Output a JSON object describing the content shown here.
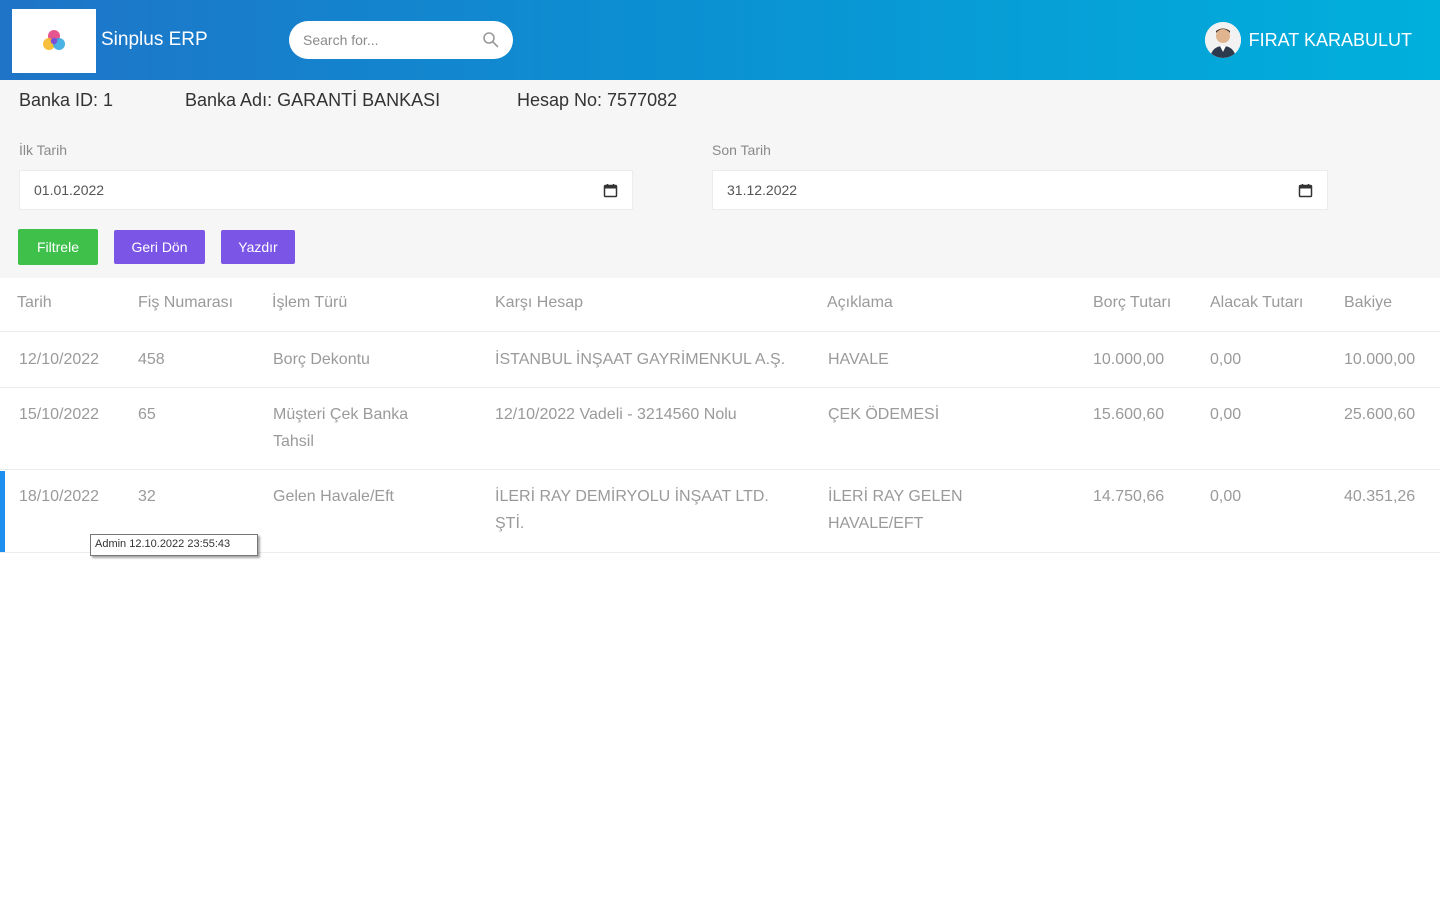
{
  "header": {
    "brand": "Sinplus ERP",
    "search_placeholder": "Search for...",
    "user_name": "FIRAT KARABULUT"
  },
  "bank": {
    "id_text": "Banka ID: 1",
    "name_text": "Banka Adı: GARANTİ BANKASI",
    "account_text": "Hesap No: 7577082"
  },
  "filters": {
    "start_label": "İlk Tarih",
    "start_value": "01.01.2022",
    "end_label": "Son Tarih",
    "end_value": "31.12.2022",
    "filter_button": "Filtrele",
    "back_button": "Geri Dön",
    "print_button": "Yazdır"
  },
  "table": {
    "columns": [
      "Tarih",
      "Fiş Numarası",
      "İşlem Türü",
      "Karşı Hesap",
      "Açıklama",
      "Borç Tutarı",
      "Alacak Tutarı",
      "Bakiye"
    ],
    "rows": [
      [
        "12/10/2022",
        "458",
        "Borç Dekontu",
        "İSTANBUL İNŞAAT GAYRİMENKUL A.Ş.",
        "HAVALE",
        "10.000,00",
        "0,00",
        "10.000,00"
      ],
      [
        "15/10/2022",
        "65",
        "Müşteri Çek Banka Tahsil",
        "12/10/2022 Vadeli - 3214560 Nolu",
        "ÇEK ÖDEMESİ",
        "15.600,60",
        "0,00",
        "25.600,60"
      ],
      [
        "18/10/2022",
        "32",
        "Gelen Havale/Eft",
        "İLERİ RAY DEMİRYOLU İNŞAAT LTD. ŞTİ.",
        "İLERİ RAY GELEN HAVALE/EFT",
        "14.750,66",
        "0,00",
        "40.351,26"
      ]
    ]
  },
  "tooltip": "Admin 12.10.2022 23:55:43",
  "colors": {
    "header_start": "#1f74c8",
    "header_end": "#00b0dc",
    "filter_button": "#3ec04b",
    "secondary_button": "#7b55e6",
    "row_marker": "#1f8fef"
  }
}
